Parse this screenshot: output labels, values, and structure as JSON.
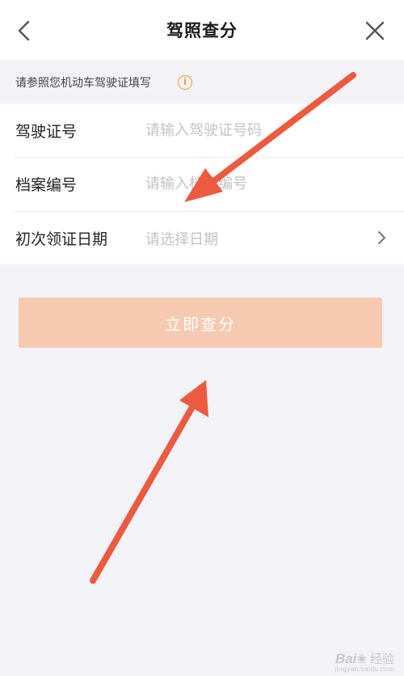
{
  "header": {
    "title": "驾照查分",
    "back_icon": "chevron-left-icon",
    "close_icon": "close-icon"
  },
  "hint": {
    "text": "请参照您机动车驾驶证填写",
    "icon": "info-icon",
    "icon_color": "#e8a034"
  },
  "form": {
    "license_number": {
      "label": "驾驶证号",
      "placeholder": "请输入驾驶证号码"
    },
    "file_number": {
      "label": "档案编号",
      "placeholder": "请输入档案编号"
    },
    "first_issue_date": {
      "label": "初次领证日期",
      "placeholder": "请选择日期"
    }
  },
  "submit": {
    "label": "立即查分",
    "color": "#f7c9b0"
  },
  "annotation": {
    "arrow_color": "#ec5a40"
  },
  "watermark": {
    "logo": "Bai",
    "logo_suffix": "经验",
    "url": "jingyan.baidu.com"
  }
}
